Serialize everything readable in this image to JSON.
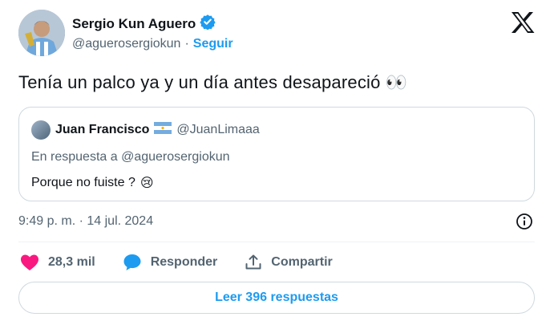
{
  "author": {
    "name": "Sergio Kun Aguero",
    "handle": "@aguerosergiokun",
    "separator": "·",
    "follow_label": "Seguir"
  },
  "tweet": {
    "text": "Tenía un palco ya y un día antes desapareció",
    "emoji": "👀"
  },
  "quoted": {
    "name": "Juan Francisco",
    "handle": "@JuanLimaaa",
    "reply_to": "En respuesta a @aguerosergiokun",
    "text": "Porque no fuiste ?",
    "emoji": "😢"
  },
  "timestamp": "9:49 p. m. · 14 jul. 2024",
  "actions": {
    "likes": "28,3 mil",
    "reply_label": "Responder",
    "share_label": "Compartir"
  },
  "read_replies_label": "Leer 396 respuestas",
  "colors": {
    "accent": "#1d9bf0",
    "like": "#f91880",
    "text": "#0f1419",
    "muted": "#536471",
    "border": "#cfd9de"
  }
}
